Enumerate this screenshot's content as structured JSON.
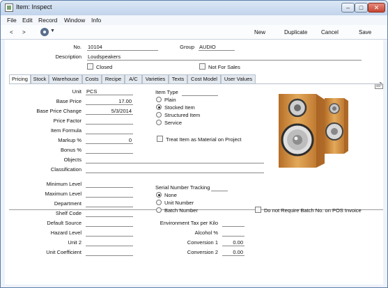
{
  "window": {
    "title": "Item: Inspect"
  },
  "menu": [
    "File",
    "Edit",
    "Record",
    "Window",
    "Info"
  ],
  "toolbar": {
    "prev": "<",
    "next": ">",
    "actions": [
      "New",
      "Duplicate",
      "Cancel",
      "Save"
    ]
  },
  "header": {
    "no_label": "No.",
    "no_value": "10104",
    "group_label": "Group",
    "group_value": "AUDIO",
    "description_label": "Description",
    "description_value": "Loudspeakers",
    "closed_label": "Closed",
    "closed_checked": false,
    "not_for_sales_label": "Not For Sales",
    "not_for_sales_checked": false
  },
  "tabs": [
    "Pricing",
    "Stock",
    "Warehouse",
    "Costs",
    "Recipe",
    "A/C",
    "Varieties",
    "Texts",
    "Cost Model",
    "User Values"
  ],
  "active_tab": "Pricing",
  "pricing": {
    "unit_label": "Unit",
    "unit_value": "PCS",
    "base_price_label": "Base Price",
    "base_price_value": "17.00",
    "base_price_change_label": "Base Price Change",
    "base_price_change_value": "5/3/2014",
    "price_factor_label": "Price Factor",
    "price_factor_value": "",
    "item_formula_label": "Item Formula",
    "item_formula_value": "",
    "markup_label": "Markup %",
    "markup_value": "0",
    "bonus_label": "Bonus %",
    "bonus_value": "",
    "objects_label": "Objects",
    "objects_value": "",
    "classification_label": "Classification",
    "classification_value": "",
    "item_type_label": "Item Type",
    "item_type_options": [
      "Plain",
      "Stocked Item",
      "Structured Item",
      "Service"
    ],
    "item_type_selected": "Stocked Item",
    "treat_as_material_label": "Treat Item as Material on Project",
    "treat_as_material_checked": false
  },
  "stock": {
    "minimum_level_label": "Minimum Level",
    "minimum_level_value": "",
    "maximum_level_label": "Maximum Level",
    "maximum_level_value": "",
    "department_label": "Department",
    "department_value": "",
    "shelf_code_label": "Shelf Code",
    "shelf_code_value": "",
    "default_source_label": "Default Source",
    "default_source_value": "",
    "hazard_level_label": "Hazard Level",
    "hazard_level_value": "",
    "unit2_label": "Unit 2",
    "unit2_value": "",
    "unit_coefficient_label": "Unit Coefficient",
    "unit_coefficient_value": "",
    "serial_tracking_label": "Serial Number Tracking",
    "serial_options": [
      "None",
      "Unit Number",
      "Batch Number"
    ],
    "serial_selected": "None",
    "no_batch_pos_label": "Do not Require Batch No. on POS Invoice",
    "no_batch_pos_checked": false,
    "env_tax_label": "Environment Tax per Kilo",
    "env_tax_value": "",
    "alcohol_label": "Alcohol %",
    "alcohol_value": "",
    "conversion1_label": "Conversion 1",
    "conversion1_value": "0.00",
    "conversion2_label": "Conversion 2",
    "conversion2_value": "0.00"
  },
  "colors": {
    "titlebar": "#c2d4ec",
    "window_bg": "#eef3fa",
    "speaker_wood": "#d79a4b"
  }
}
